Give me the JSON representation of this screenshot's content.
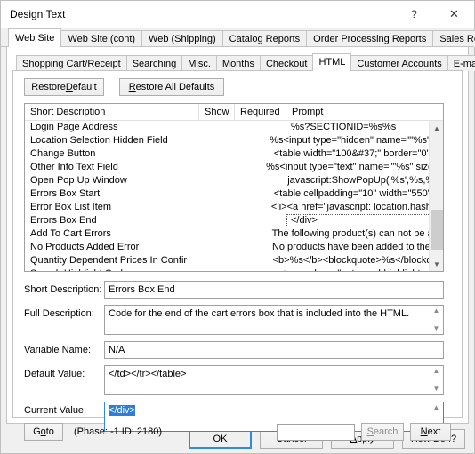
{
  "window": {
    "title": "Design Text",
    "help_icon": "?",
    "close_icon": "✕"
  },
  "outer_tabs": [
    {
      "label": "Web Site",
      "active": true
    },
    {
      "label": "Web Site (cont)",
      "active": false
    },
    {
      "label": "Web (Shipping)",
      "active": false
    },
    {
      "label": "Catalog Reports",
      "active": false
    },
    {
      "label": "Order Processing Reports",
      "active": false
    },
    {
      "label": "Sales Reports",
      "active": false
    }
  ],
  "inner_tabs": [
    {
      "label": "Shopping Cart/Receipt",
      "active": false
    },
    {
      "label": "Searching",
      "active": false
    },
    {
      "label": "Misc.",
      "active": false
    },
    {
      "label": "Months",
      "active": false
    },
    {
      "label": "Checkout",
      "active": false
    },
    {
      "label": "HTML",
      "active": true
    },
    {
      "label": "Customer Accounts",
      "active": false
    },
    {
      "label": "E-mail",
      "active": false
    }
  ],
  "toolbar": {
    "restore_default": {
      "pre": "Restore ",
      "key": "D",
      "post": "efault"
    },
    "restore_all_defaults": {
      "pre": "",
      "key": "R",
      "post": "estore All Defaults"
    }
  },
  "list": {
    "columns": [
      "Short Description",
      "Show",
      "Required",
      "Prompt"
    ],
    "rows": [
      {
        "desc": "Login Page Address",
        "show": "",
        "required": "",
        "prompt": "%s?SECTIONID=%s%s",
        "selected": false
      },
      {
        "desc": "Location Selection Hidden Field",
        "show": "",
        "required": "",
        "prompt": "%s<input type=\"hidden\" name=\"\"%s\" valu...",
        "selected": false
      },
      {
        "desc": "Change Button",
        "show": "",
        "required": "",
        "prompt": "<table width=\"100&#37;\" border=\"0\" cell...",
        "selected": false
      },
      {
        "desc": "Other Info Text Field",
        "show": "",
        "required": "",
        "prompt": "%s<input type=\"text\" name=\"\"%s\" size=\"\"%...",
        "selected": false
      },
      {
        "desc": "Open Pop Up Window",
        "show": "",
        "required": "",
        "prompt": "javascript:ShowPopUp('%s',%s,%s);",
        "selected": false
      },
      {
        "desc": "Errors Box Start",
        "show": "",
        "required": "",
        "prompt": "<table cellpadding=\"10\" width=\"550\" bor...",
        "selected": false
      },
      {
        "desc": "Error Box List Item",
        "show": "",
        "required": "",
        "prompt": "<li><a  href=\"javascript: location.hash = 'a...",
        "selected": false
      },
      {
        "desc": "Errors Box End",
        "show": "",
        "required": "",
        "prompt": "</div>",
        "selected": true
      },
      {
        "desc": "Add To Cart Errors",
        "show": "",
        "required": "",
        "prompt": "The following product(s) can not be adde...",
        "selected": false
      },
      {
        "desc": "No Products Added Error",
        "show": "",
        "required": "",
        "prompt": "No products have been added to the sho...",
        "selected": false
      },
      {
        "desc": "Quantity Dependent Prices In Confirmatio...",
        "show": "",
        "required": "",
        "prompt": "<b>%s</b><blockquote>%s</blockquote>",
        "selected": false
      },
      {
        "desc": "Search Highlight Code",
        "show": "",
        "required": "",
        "prompt": "<span class=\"notsearchhighlightcolor\">",
        "selected": false
      }
    ],
    "scroll": {
      "up_arrow": "▲",
      "down_arrow": "▼"
    }
  },
  "detail": {
    "short_description_label": "Short Description:",
    "short_description_value": "Errors Box End",
    "full_description_label": "Full Description:",
    "full_description_value": "Code for the end of the cart errors box that is included into the HTML.",
    "variable_name_label": "Variable Name:",
    "variable_name_value": "N/A",
    "default_value_label": "Default Value:",
    "default_value_value": "</td></tr></table>",
    "current_value_label": "Current Value:",
    "current_value_value": "</div>"
  },
  "bottom": {
    "goto": {
      "pre": "G",
      "key": "o",
      "post": " to"
    },
    "phase_text": "(Phase: -1  ID: 2180)",
    "search_value": "",
    "search_button": {
      "pre": "",
      "key": "S",
      "post": "earch"
    },
    "next_button": {
      "pre": "",
      "key": "N",
      "post": "ext"
    }
  },
  "footer": {
    "ok": "OK",
    "cancel": "Cancel",
    "apply": {
      "pre": "",
      "key": "A",
      "post": "pply"
    },
    "how_do_i": "How Do I?"
  },
  "colors": {
    "accent": "#2e8ae5",
    "selection": "#2e7dd7",
    "window_bg": "#f0f0f0",
    "panel_bg": "#ffffff"
  }
}
